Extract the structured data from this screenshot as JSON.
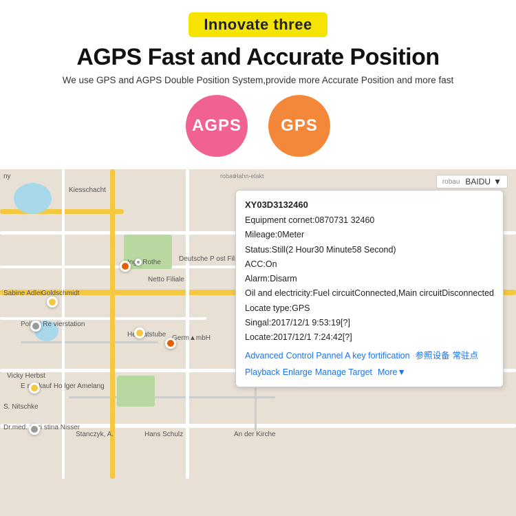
{
  "header": {
    "badge": "Innovate three",
    "title": "AGPS Fast and Accurate Position",
    "subtitle": "We use GPS and AGPS Double Position System,provide more Accurate Position and more fast"
  },
  "icons": {
    "agps": "AGPS",
    "gps": "GPS"
  },
  "map": {
    "labels": {
      "ny": "ny",
      "kiesschacht": "Kiesschacht",
      "ingo_rothe": "Ingo Rothe",
      "sabine_adler": "Sabine Adler",
      "netto": "Netto Filiale",
      "deutsche": "Deutsche P\nost Filiale",
      "goldschmidt": "Goldschmidt",
      "heimatstube": "Heimatstube",
      "polizei": "Polizei Re\nvierstation",
      "vicky": "Vicky Herbst",
      "s_nitschke": "S. Nitschke",
      "eneukauf": "E neukauf Ho\nlger Amelang",
      "drmed": "Dr.med. Chri\nstina Nisser",
      "stanczyk": "Stanczyk, A.",
      "hans_schulz": "Hans Schulz",
      "an_der_kirche": "An der Kirche",
      "hahn": "Hahn-elakt",
      "robau": "robau",
      "germ": "Germ▲mbH"
    },
    "dropdown": {
      "robau_label": "robau",
      "baidu_label": "BAIDU"
    }
  },
  "popup": {
    "device_id": "XY03D3132460",
    "equipment_label": "Equipment cornet:",
    "equipment_value": "0870731 32460",
    "mileage_label": "Mileage:",
    "mileage_value": "0Meter",
    "status_label": "Status:",
    "status_value": "Still(2 Hour30 Minute58 Second)",
    "acc_label": "ACC:",
    "acc_value": "On",
    "alarm_label": "Alarm:",
    "alarm_value": "Disarm",
    "oil_label": "Oil and electricity:",
    "oil_value": "Fuel circuitConnected,Main circuitDisconnected",
    "locate_type_label": "Locate type:",
    "locate_type_value": "GPS",
    "signal_label": "Singal:",
    "signal_value": "2017/12/1 9:53:19[?]",
    "locate_label": "Locate:",
    "locate_value": "2017/12/1 7:24:42[?]",
    "links": {
      "advanced": "Advanced",
      "control_panel": "Control Pannel A key fortification",
      "fortification": "",
      "canjiao": "参照设备",
      "changzhudian": "常驻点",
      "playback": "Playback",
      "enlarge": "Enlarge",
      "manage": "Manage Target",
      "target": "",
      "more": "More▼"
    }
  }
}
